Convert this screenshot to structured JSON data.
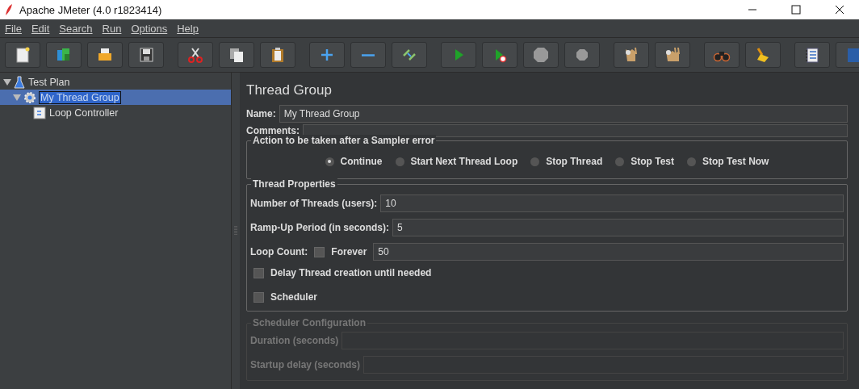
{
  "window": {
    "title": "Apache JMeter (4.0 r1823414)"
  },
  "menu": [
    "File",
    "Edit",
    "Search",
    "Run",
    "Options",
    "Help"
  ],
  "toolbar_groups": [
    [
      {
        "kind": "new"
      },
      {
        "kind": "templates"
      },
      {
        "kind": "open"
      },
      {
        "kind": "save"
      }
    ],
    [
      {
        "kind": "cut"
      },
      {
        "kind": "copy"
      },
      {
        "kind": "paste"
      }
    ],
    [
      {
        "kind": "expand"
      },
      {
        "kind": "collapse"
      },
      {
        "kind": "toggle"
      }
    ],
    [
      {
        "kind": "start"
      },
      {
        "kind": "start-no-pause"
      },
      {
        "kind": "stop"
      },
      {
        "kind": "shutdown"
      }
    ],
    [
      {
        "kind": "clear"
      },
      {
        "kind": "clear-all"
      }
    ],
    [
      {
        "kind": "search"
      },
      {
        "kind": "reset-search"
      }
    ],
    [
      {
        "kind": "function-helper"
      },
      {
        "kind": "help"
      }
    ]
  ],
  "tree": [
    {
      "label": "Test Plan",
      "kind": "plan",
      "expanded": true,
      "selected": false,
      "children": [
        {
          "label": "My Thread Group",
          "kind": "thread-group",
          "expanded": true,
          "selected": true,
          "children": [
            {
              "label": "Loop Controller",
              "kind": "loop",
              "selected": false
            }
          ]
        }
      ]
    }
  ],
  "panel": {
    "title": "Thread Group",
    "name": {
      "label": "Name:",
      "value": "My Thread Group"
    },
    "comments": {
      "label": "Comments:"
    },
    "sampler_error": {
      "legend": "Action to be taken after a Sampler error",
      "options": [
        {
          "label": "Continue",
          "selected": true
        },
        {
          "label": "Start Next Thread Loop",
          "selected": false
        },
        {
          "label": "Stop Thread",
          "selected": false
        },
        {
          "label": "Stop Test",
          "selected": false
        },
        {
          "label": "Stop Test Now",
          "selected": false
        }
      ]
    },
    "thread_properties": {
      "legend": "Thread Properties",
      "threads": {
        "label": "Number of Threads (users):",
        "value": "10"
      },
      "ramp_up": {
        "label": "Ramp-Up Period (in seconds):",
        "value": "5"
      },
      "loop_count": {
        "label": "Loop Count:",
        "forever": {
          "label": "Forever",
          "checked": false
        },
        "value": "50"
      },
      "delay": {
        "label": "Delay Thread creation until needed",
        "checked": false
      },
      "scheduler": {
        "label": "Scheduler",
        "checked": false
      }
    },
    "scheduler_configuration": {
      "legend": "Scheduler Configuration",
      "disabled": true,
      "duration": {
        "label": "Duration (seconds)"
      },
      "startup_delay": {
        "label": "Startup delay (seconds)"
      }
    }
  }
}
